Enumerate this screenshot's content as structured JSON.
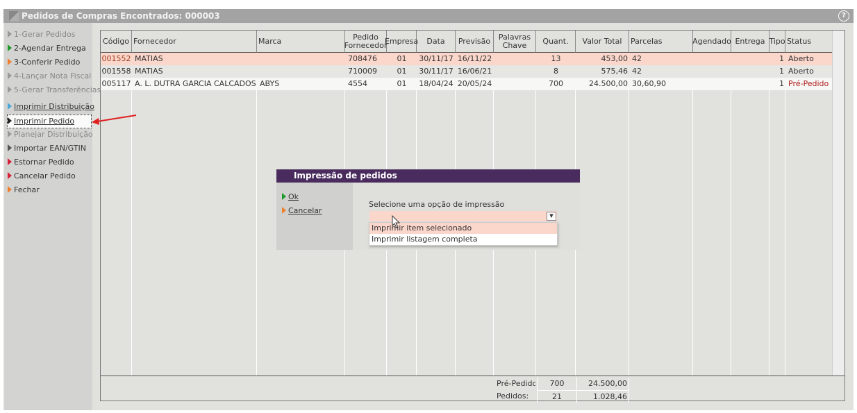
{
  "window": {
    "title": "Pedidos de Compras Encontrados: 000003",
    "help_icon": "?"
  },
  "sidebar": {
    "items": [
      {
        "label": "1-Gerar Pedidos",
        "color": "#999999",
        "disabled": true
      },
      {
        "label": "2-Agendar Entrega",
        "color": "#1f9a2a",
        "disabled": false
      },
      {
        "label": "3-Conferir Pedido",
        "color": "#f08030",
        "disabled": false
      },
      {
        "label": "4-Lançar Nota Fiscal",
        "color": "#999999",
        "disabled": true
      },
      {
        "label": "5-Gerar Transferências",
        "color": "#999999",
        "disabled": true
      },
      {
        "label": "Imprimir Distribuição",
        "color": "#4aa8d8",
        "disabled": false
      },
      {
        "label": "Imprimir Pedido",
        "color": "#222222",
        "disabled": false
      },
      {
        "label": "Planejar Distribuição",
        "color": "#999999",
        "disabled": true
      },
      {
        "label": "Importar EAN/GTIN",
        "color": "#555555",
        "disabled": false
      },
      {
        "label": "Estornar Pedido",
        "color": "#d8203a",
        "disabled": false
      },
      {
        "label": "Cancelar Pedido",
        "color": "#d8203a",
        "disabled": false
      },
      {
        "label": "Fechar",
        "color": "#f08030",
        "disabled": false
      }
    ]
  },
  "table": {
    "columns": [
      "Código",
      "Fornecedor",
      "Marca",
      "Pedido Fornecedor",
      "Empresa",
      "Data",
      "Previsão",
      "Palavras Chave",
      "Quant.",
      "Valor Total",
      "Parcelas",
      "Agendado",
      "Entrega",
      "Tipo",
      "Status"
    ],
    "rows": [
      [
        "001552",
        "MATIAS",
        "",
        "708476",
        "01",
        "30/11/17",
        "16/11/22",
        "",
        "13",
        "453,00",
        "42",
        "",
        "",
        "1",
        "Aberto"
      ],
      [
        "001558",
        "MATIAS",
        "",
        "710009",
        "01",
        "30/11/17",
        "16/06/21",
        "",
        "8",
        "575,46",
        "42",
        "",
        "",
        "1",
        "Aberto"
      ],
      [
        "005117",
        "A. L. DUTRA GARCIA CALCADOS ME",
        "ABYS",
        "4554",
        "01",
        "18/04/24",
        "20/05/24",
        "",
        "700",
        "24.500,00",
        "30,60,90",
        "",
        "",
        "1",
        "Pré-Pedido"
      ]
    ],
    "row_colors": [
      "#fbd6cb",
      "#e6e6e2",
      "#f7f7f5"
    ],
    "prepedido_color": "#b01c1c"
  },
  "footer": {
    "pre_label": "Pré-Pedidos:",
    "pre_qty": "700",
    "pre_total": "24.500,00",
    "ped_label": "Pedidos:",
    "ped_qty": "21",
    "ped_total": "1.028,46"
  },
  "dialog": {
    "title": "Impressão de pedidos",
    "ok": "Ok",
    "cancel": "Cancelar",
    "prompt": "Selecione uma opção de impressão",
    "selected": "",
    "options": [
      "Imprimir item selecionado",
      "Imprimir listagem completa"
    ]
  }
}
